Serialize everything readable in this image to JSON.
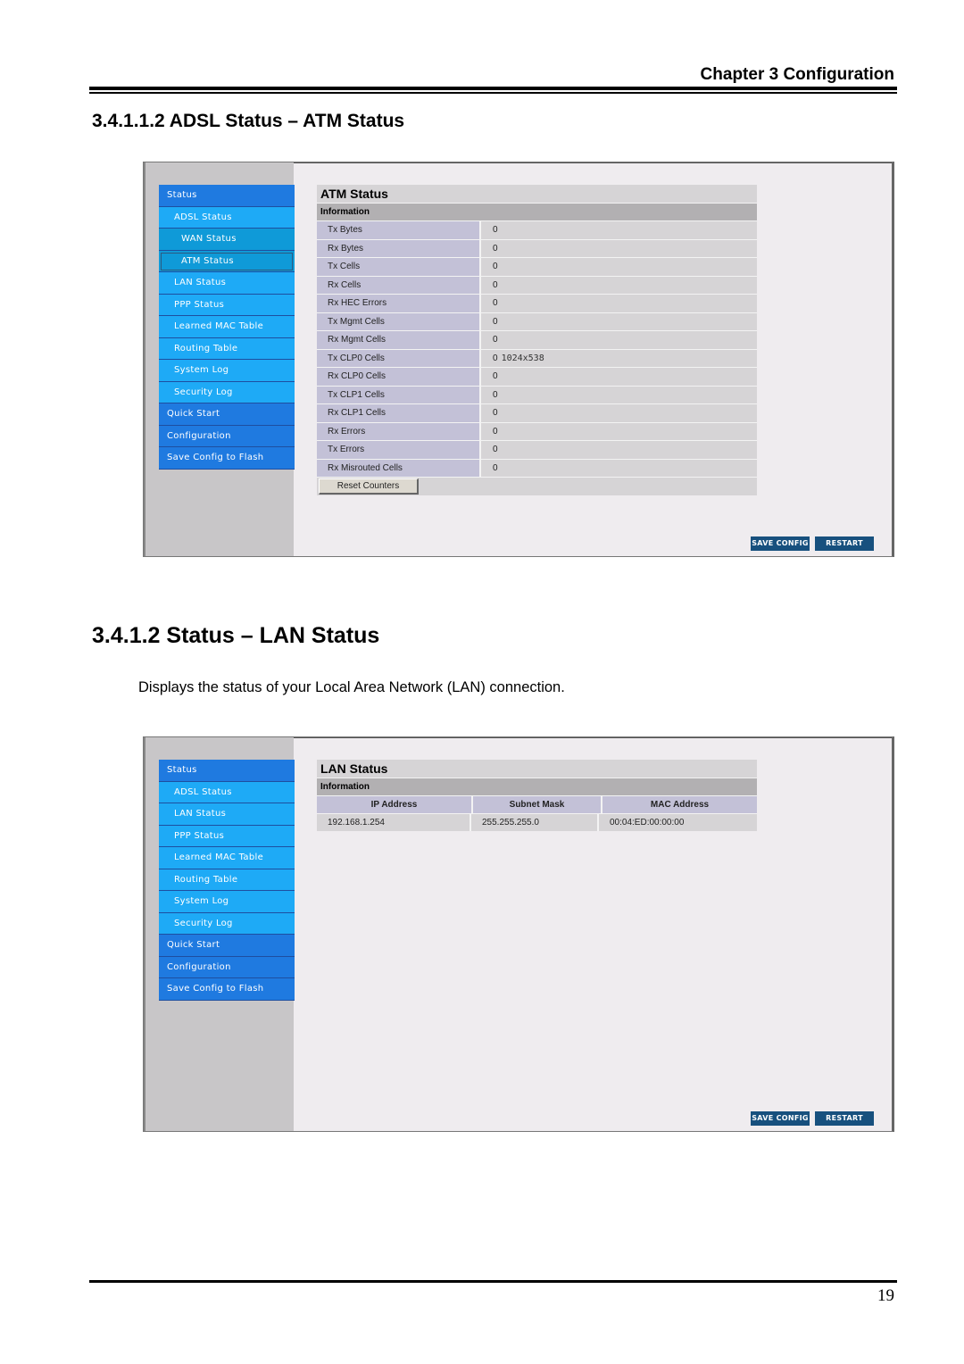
{
  "header": {
    "chapter": "Chapter 3 Configuration"
  },
  "section_atm": {
    "heading": "3.4.1.1.2 ADSL Status – ATM Status",
    "screenshot": {
      "nav": [
        {
          "label": "Status",
          "level": "top"
        },
        {
          "label": "ADSL Status",
          "level": "sub"
        },
        {
          "label": "WAN Status",
          "level": "sub2"
        },
        {
          "label": "ATM Status",
          "level": "sub2",
          "selected": true
        },
        {
          "label": "LAN Status",
          "level": "sub"
        },
        {
          "label": "PPP Status",
          "level": "sub"
        },
        {
          "label": "Learned MAC Table",
          "level": "sub"
        },
        {
          "label": "Routing Table",
          "level": "sub"
        },
        {
          "label": "System Log",
          "level": "sub"
        },
        {
          "label": "Security Log",
          "level": "sub"
        },
        {
          "label": "Quick Start",
          "level": "top"
        },
        {
          "label": "Configuration",
          "level": "top"
        },
        {
          "label": "Save Config to Flash",
          "level": "top"
        }
      ],
      "title": "ATM Status",
      "info_label": "Information",
      "rows": [
        {
          "k": "Tx Bytes",
          "v": "0"
        },
        {
          "k": "Rx Bytes",
          "v": "0"
        },
        {
          "k": "Tx Cells",
          "v": "0"
        },
        {
          "k": "Rx Cells",
          "v": "0"
        },
        {
          "k": "Rx HEC Errors",
          "v": "0"
        },
        {
          "k": "Tx Mgmt Cells",
          "v": "0"
        },
        {
          "k": "Rx Mgmt Cells",
          "v": "0"
        },
        {
          "k": "Tx CLP0 Cells",
          "v": "0",
          "overlay": "1024x538"
        },
        {
          "k": "Rx CLP0 Cells",
          "v": "0"
        },
        {
          "k": "Tx CLP1 Cells",
          "v": "0"
        },
        {
          "k": "Rx CLP1 Cells",
          "v": "0"
        },
        {
          "k": "Rx Errors",
          "v": "0"
        },
        {
          "k": "Tx Errors",
          "v": "0"
        },
        {
          "k": "Rx Misrouted Cells",
          "v": "0"
        }
      ],
      "reset_label": "Reset Counters",
      "save_config": "SAVE CONFIG",
      "restart": "RESTART"
    }
  },
  "section_lan": {
    "heading": "3.4.1.2 Status – LAN Status",
    "description": "Displays the status of your Local Area Network (LAN) connection.",
    "screenshot": {
      "nav": [
        {
          "label": "Status",
          "level": "top"
        },
        {
          "label": "ADSL Status",
          "level": "sub"
        },
        {
          "label": "LAN Status",
          "level": "sub"
        },
        {
          "label": "PPP Status",
          "level": "sub"
        },
        {
          "label": "Learned MAC Table",
          "level": "sub"
        },
        {
          "label": "Routing Table",
          "level": "sub"
        },
        {
          "label": "System Log",
          "level": "sub"
        },
        {
          "label": "Security Log",
          "level": "sub"
        },
        {
          "label": "Quick Start",
          "level": "top"
        },
        {
          "label": "Configuration",
          "level": "top"
        },
        {
          "label": "Save Config to Flash",
          "level": "top"
        }
      ],
      "title": "LAN Status",
      "info_label": "Information",
      "columns": [
        "IP Address",
        "Subnet Mask",
        "MAC Address"
      ],
      "values": [
        "192.168.1.254",
        "255.255.255.0",
        "00:04:ED:00:00:00"
      ],
      "save_config": "SAVE CONFIG",
      "restart": "RESTART"
    }
  },
  "footer": {
    "page_number": "19"
  }
}
